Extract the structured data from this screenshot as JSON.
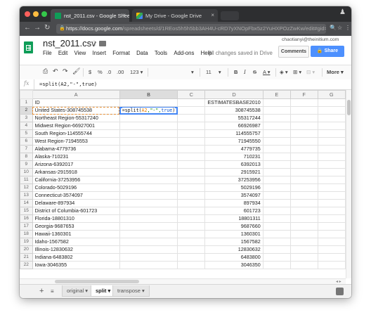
{
  "browser": {
    "tabs": [
      {
        "title": "nst_2011.csv - Google Sheets",
        "active": true
      },
      {
        "title": "My Drive - Google Drive",
        "active": false
      }
    ],
    "url_host": "https://docs.google.com",
    "url_rest": "/spreadsheets/d/1REos5h5h5bb3AH4U-cRD7yXNOpFbx5z2YuHXPOzZwKw/edit#gid=..."
  },
  "doc": {
    "title": "nst_2011.csv",
    "user": "chaotianyi@theinitium.com",
    "saved_status": "All changes saved in Drive",
    "comments_label": "Comments",
    "share_label": "Share",
    "menus": [
      "File",
      "Edit",
      "View",
      "Insert",
      "Format",
      "Data",
      "Tools",
      "Add-ons",
      "Help"
    ]
  },
  "toolbar": {
    "currency": "$",
    "percent": "%",
    "dec_less": ".0",
    "dec_more": ".00",
    "format_123": "123",
    "font_size": "11",
    "bold": "B",
    "italic": "I",
    "strike": "S",
    "text_color": "A",
    "more": "More"
  },
  "formula_bar": {
    "fx": "fx",
    "content": "=split(A2,\"-\",true)"
  },
  "grid": {
    "columns": [
      "A",
      "B",
      "C",
      "D",
      "E",
      "F",
      "G"
    ],
    "selected_column": "B",
    "selected_row": 2,
    "editor": {
      "fn": "=split(",
      "ref": "A2",
      "mid": ",\"-\",",
      "kw": "true",
      "end": ")"
    },
    "rows": [
      {
        "n": "1",
        "a": "ID",
        "d": "ESTIMATESBASE2010"
      },
      {
        "n": "2",
        "a": "United States-308745538",
        "d": "308745538"
      },
      {
        "n": "3",
        "a": "Northeast Region-55317240",
        "d": "55317244"
      },
      {
        "n": "4",
        "a": "Midwest Region-66927001",
        "d": "66926987"
      },
      {
        "n": "5",
        "a": "South Region-114555744",
        "d": "114555757"
      },
      {
        "n": "6",
        "a": "West Region-71945553",
        "d": "71945550"
      },
      {
        "n": "7",
        "a": "Alabama-4779736",
        "d": "4779735"
      },
      {
        "n": "8",
        "a": "Alaska-710231",
        "d": "710231"
      },
      {
        "n": "9",
        "a": "Arizona-6392017",
        "d": "6392013"
      },
      {
        "n": "10",
        "a": "Arkansas-2915918",
        "d": "2915921"
      },
      {
        "n": "11",
        "a": "California-37253956",
        "d": "37253956"
      },
      {
        "n": "12",
        "a": "Colorado-5029196",
        "d": "5029196"
      },
      {
        "n": "13",
        "a": "Connecticut-3574097",
        "d": "3574097"
      },
      {
        "n": "14",
        "a": "Delaware-897934",
        "d": "897934"
      },
      {
        "n": "15",
        "a": "District of Columbia-601723",
        "d": "601723"
      },
      {
        "n": "16",
        "a": "Florida-18801310",
        "d": "18801311"
      },
      {
        "n": "17",
        "a": "Georgia-9687653",
        "d": "9687660"
      },
      {
        "n": "18",
        "a": "Hawaii-1360301",
        "d": "1360301"
      },
      {
        "n": "19",
        "a": "Idaho-1567582",
        "d": "1567582"
      },
      {
        "n": "20",
        "a": "Illinois-12830632",
        "d": "12830632"
      },
      {
        "n": "21",
        "a": "Indiana-6483802",
        "d": "6483800"
      },
      {
        "n": "22",
        "a": "Iowa-3046355",
        "d": "3046350"
      }
    ]
  },
  "sheet_tabs": [
    {
      "label": "original",
      "active": false
    },
    {
      "label": "split",
      "active": true
    },
    {
      "label": "transpose",
      "active": false
    }
  ],
  "colors": {
    "sheets_green": "#0f9d58",
    "share_blue": "#4d90fe",
    "selection_blue": "#4285f4",
    "copy_orange": "#e69138"
  }
}
